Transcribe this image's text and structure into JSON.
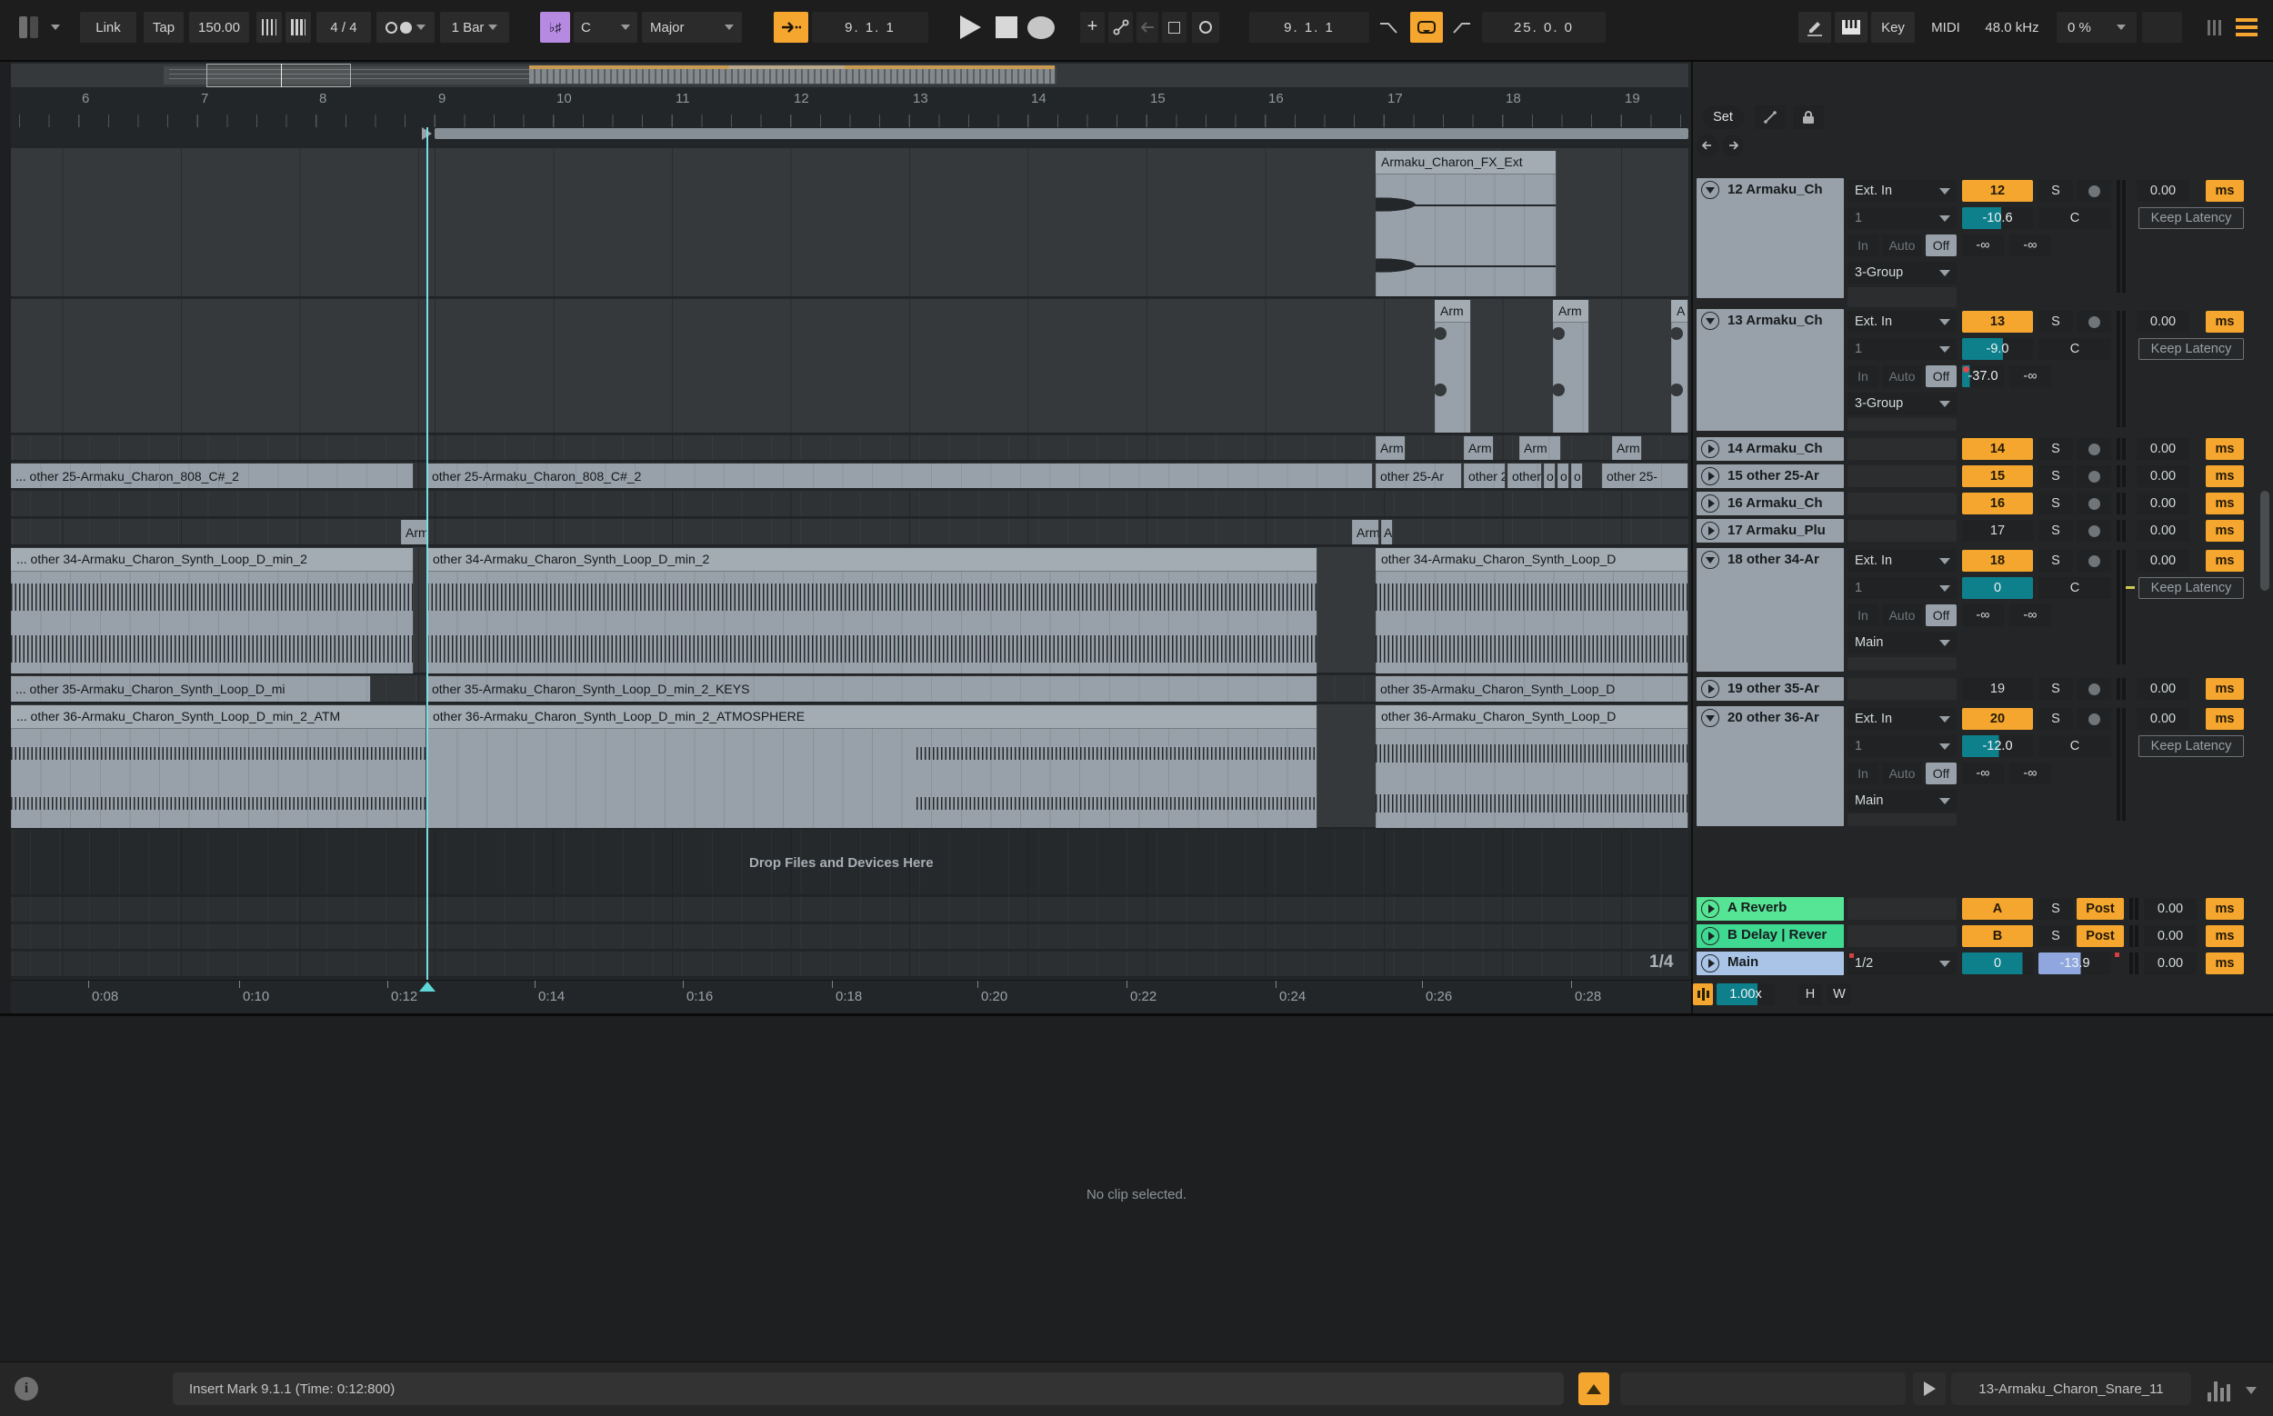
{
  "toolbar": {
    "link": "Link",
    "tap": "Tap",
    "tempo": "150.00",
    "time_signature": "4 / 4",
    "quantization": "1 Bar",
    "scale_icon": "♭♯",
    "scale_root": "C",
    "scale_mode": "Major",
    "arrangement_position": "9. 1. 1",
    "loop_start": "9. 1. 1",
    "loop_length": "25. 0. 0",
    "key": "Key",
    "midi": "MIDI",
    "sample_rate": "48.0 kHz",
    "cpu_load": "0 %"
  },
  "ruler": {
    "bars": [
      "6",
      "7",
      "8",
      "9",
      "10",
      "11",
      "12",
      "13",
      "14",
      "15",
      "16",
      "17",
      "18",
      "19"
    ]
  },
  "time_ruler": {
    "labels": [
      "0:08",
      "0:10",
      "0:12",
      "0:14",
      "0:16",
      "0:18",
      "0:20",
      "0:22",
      "0:24",
      "0:26",
      "0:28"
    ]
  },
  "tracks_area": {
    "drop_hint": "Drop Files and Devices Here",
    "grid_value": "1/4",
    "clips": {
      "fx": "Armaku_Charon_FX_Ext",
      "arm": "Arm",
      "arm_a": "A",
      "o": "o",
      "t25_left": "... other 25-Armaku_Charon_808_C#_2",
      "t25_mid": "other 25-Armaku_Charon_808_C#_2",
      "t25_r1": "other 25-Ar",
      "t25_r2": "other 2",
      "t25_r3": "other",
      "t25_r4": "other 25-",
      "t34_left": "... other 34-Armaku_Charon_Synth_Loop_D_min_2",
      "t34_mid": "other 34-Armaku_Charon_Synth_Loop_D_min_2",
      "t34_right": "other 34-Armaku_Charon_Synth_Loop_D",
      "t35_left": "... other 35-Armaku_Charon_Synth_Loop_D_mi",
      "t35_mid": "other 35-Armaku_Charon_Synth_Loop_D_min_2_KEYS",
      "t35_right": "other 35-Armaku_Charon_Synth_Loop_D",
      "t36_left": "... other 36-Armaku_Charon_Synth_Loop_D_min_2_ATM",
      "t36_mid": "other 36-Armaku_Charon_Synth_Loop_D_min_2_ATMOSPHERE",
      "t36_right": "other 36-Armaku_Charon_Synth_Loop_D"
    }
  },
  "mixer": {
    "set_label": "Set",
    "tracks": [
      {
        "name": "12 Armaku_Ch",
        "number": "12",
        "solo": "S",
        "input_type": "Ext. In",
        "input_channel": "1",
        "monitor": [
          "In",
          "Auto",
          "Off"
        ],
        "output": "3-Group",
        "volume": "-10.6",
        "pan": "C",
        "send_a": "-∞",
        "send_b": "-∞",
        "delay": "0.00",
        "delay_unit": "ms",
        "keep_latency": "Keep Latency"
      },
      {
        "name": "13 Armaku_Ch",
        "number": "13",
        "solo": "S",
        "input_type": "Ext. In",
        "input_channel": "1",
        "monitor": [
          "In",
          "Auto",
          "Off"
        ],
        "output": "3-Group",
        "volume": "-9.0",
        "pan": "C",
        "send_a": "-37.0",
        "send_b": "-∞",
        "delay": "0.00",
        "delay_unit": "ms",
        "keep_latency": "Keep Latency"
      },
      {
        "name": "14 Armaku_Ch",
        "number": "14",
        "solo": "S",
        "delay": "0.00",
        "delay_unit": "ms"
      },
      {
        "name": "15 other 25-Ar",
        "number": "15",
        "solo": "S",
        "delay": "0.00",
        "delay_unit": "ms"
      },
      {
        "name": "16 Armaku_Ch",
        "number": "16",
        "solo": "S",
        "delay": "0.00",
        "delay_unit": "ms"
      },
      {
        "name": "17 Armaku_Plu",
        "number": "17",
        "solo": "S",
        "delay": "0.00",
        "delay_unit": "ms"
      },
      {
        "name": "18 other 34-Ar",
        "number": "18",
        "solo": "S",
        "input_type": "Ext. In",
        "input_channel": "1",
        "monitor": [
          "In",
          "Auto",
          "Off"
        ],
        "output": "Main",
        "volume": "0",
        "pan": "C",
        "send_a": "-∞",
        "send_b": "-∞",
        "delay": "0.00",
        "delay_unit": "ms",
        "keep_latency": "Keep Latency"
      },
      {
        "name": "19 other 35-Ar",
        "number": "19",
        "solo": "S",
        "delay": "0.00",
        "delay_unit": "ms"
      },
      {
        "name": "20 other 36-Ar",
        "number": "20",
        "solo": "S",
        "input_type": "Ext. In",
        "input_channel": "1",
        "monitor": [
          "In",
          "Auto",
          "Off"
        ],
        "output": "Main",
        "volume": "-12.0",
        "pan": "C",
        "send_a": "-∞",
        "send_b": "-∞",
        "delay": "0.00",
        "delay_unit": "ms",
        "keep_latency": "Keep Latency"
      }
    ],
    "returns": [
      {
        "name": "A Reverb",
        "number": "A",
        "solo": "S",
        "post": "Post",
        "delay": "0.00",
        "delay_unit": "ms"
      },
      {
        "name": "B Delay | Rever",
        "number": "B",
        "solo": "S",
        "post": "Post",
        "delay": "0.00",
        "delay_unit": "ms"
      },
      {
        "name": "Main",
        "routing": "1/2",
        "volume": "0",
        "cue": "-13.9",
        "delay": "0.00",
        "delay_unit": "ms"
      }
    ],
    "footer": {
      "speed": "1.00x",
      "h": "H",
      "w": "W"
    }
  },
  "clip_view": {
    "message": "No clip selected."
  },
  "status_bar": {
    "message": "Insert Mark 9.1.1 (Time: 0:12:800)",
    "preview_file": "13-Armaku_Charon_Snare_11"
  },
  "colors": {
    "accent_orange": "#f5a62f",
    "teal": "#0d808c",
    "playhead": "#79dde2",
    "return_a_green": "#55e594",
    "return_b_green": "#3fd992",
    "main_blue": "#a9c4e6",
    "scale_purple": "#b58ae0",
    "clip_gray": "#98a1a9"
  }
}
